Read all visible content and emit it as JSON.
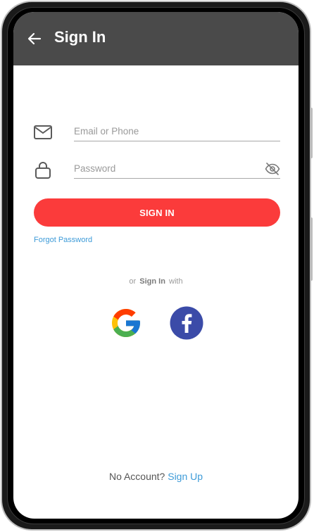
{
  "appbar": {
    "title": "Sign In"
  },
  "form": {
    "email_placeholder": "Email or Phone",
    "password_placeholder": "Password",
    "signin_label": "SIGN IN",
    "forgot_label": "Forgot Password"
  },
  "social": {
    "prefix": "or",
    "strong": "Sign In",
    "suffix": "with",
    "providers": [
      "google",
      "facebook"
    ]
  },
  "footer": {
    "text": "No Account?",
    "link": "Sign Up"
  },
  "colors": {
    "appbar": "#4a4a4a",
    "primary": "#fb3b3b",
    "link": "#3d9bd8",
    "facebook": "#3b4ba8"
  },
  "icons": {
    "back": "arrow-left-icon",
    "email": "mail-icon",
    "password": "lock-icon",
    "visibility": "eye-off-icon"
  }
}
